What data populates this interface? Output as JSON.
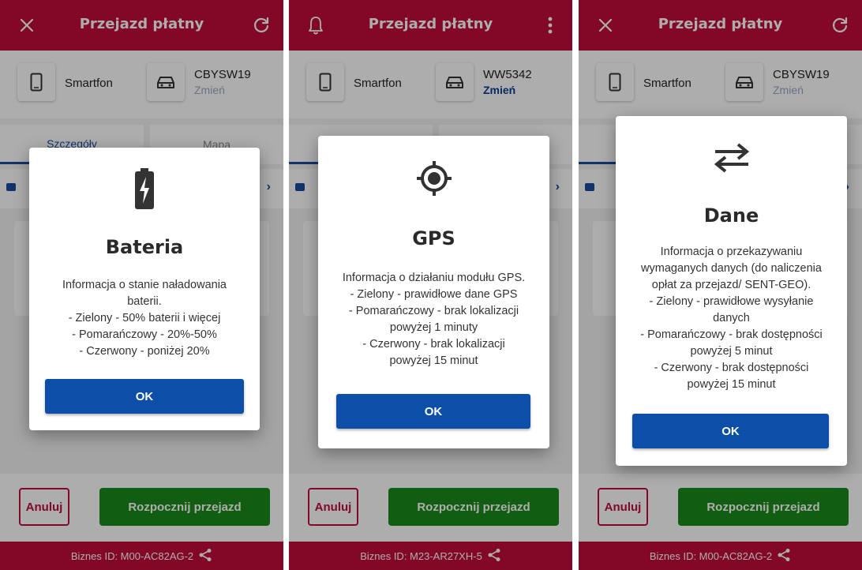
{
  "colors": {
    "header": "#c20d3c",
    "ok_button": "#0d4fa8",
    "start_button": "#1a8a1a",
    "overlay": "rgba(0,0,0,0.32)"
  },
  "screens": [
    {
      "header": {
        "title": "Przejazd płatny",
        "left_icon": "close-icon",
        "right_icon": "refresh-icon"
      },
      "device_label": "Smartfon",
      "plate": "CBYSW19",
      "change_label": "Zmień",
      "tabs": [
        "Szczegóły",
        "Mapa"
      ],
      "dialog": {
        "icon": "battery-charging-icon",
        "title": "Bateria",
        "body": [
          "Informacja o stanie naładowania",
          "baterii.",
          "- Zielony - 50% baterii i więcej",
          "- Pomarańczowy - 20%-50%",
          "- Czerwony - poniżej 20%"
        ],
        "ok": "OK"
      },
      "cancel_label": "Anuluj",
      "start_label": "Rozpocznij przejazd",
      "business_id": "Biznes ID:  M00-AC82AG-2"
    },
    {
      "header": {
        "title": "Przejazd płatny",
        "left_icon": "bell-icon",
        "right_icon": "more-vert-icon"
      },
      "device_label": "Smartfon",
      "plate": "WW5342",
      "change_label": "Zmień",
      "dialog": {
        "icon": "gps-target-icon",
        "title": "GPS",
        "body": [
          "Informacja o działaniu modułu GPS.",
          "- Zielony - prawidłowe dane GPS",
          "- Pomarańczowy - brak lokalizacji",
          "powyżej 1 minuty",
          "- Czerwony - brak lokalizacji",
          "powyżej 15 minut"
        ],
        "ok": "OK"
      },
      "cancel_label": "Anuluj",
      "start_label": "Rozpocznij przejazd",
      "business_id": "Biznes ID:  M23-AR27XH-5"
    },
    {
      "header": {
        "title": "Przejazd płatny",
        "left_icon": "close-icon",
        "right_icon": "refresh-icon"
      },
      "device_label": "Smartfon",
      "plate": "CBYSW19",
      "change_label": "Zmień",
      "dialog": {
        "icon": "swap-arrows-icon",
        "title": "Dane",
        "body": [
          "Informacja o przekazywaniu",
          "wymaganych danych (do naliczenia",
          "opłat za przejazd/ SENT-GEO).",
          "- Zielony - prawidłowe wysyłanie",
          "danych",
          "- Pomarańczowy - brak dostępności",
          "powyżej 5 minut",
          "- Czerwony - brak dostępności",
          "powyżej 15 minut"
        ],
        "ok": "OK"
      },
      "cancel_label": "Anuluj",
      "start_label": "Rozpocznij przejazd",
      "business_id": "Biznes ID:  M00-AC82AG-2"
    }
  ]
}
